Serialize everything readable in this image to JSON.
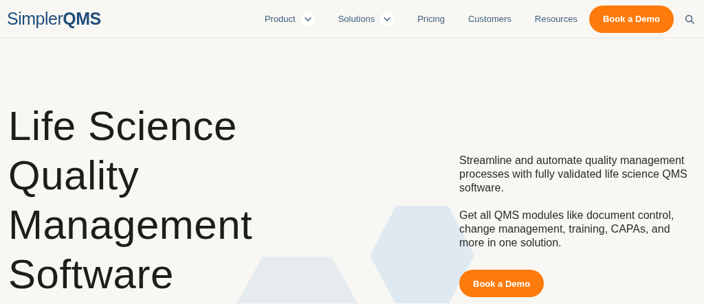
{
  "logo": {
    "name": "Simpler",
    "accent": "QMS"
  },
  "nav": [
    {
      "label": "Product",
      "dropdown": true
    },
    {
      "label": "Solutions",
      "dropdown": true
    },
    {
      "label": "Pricing",
      "dropdown": false
    },
    {
      "label": "Customers",
      "dropdown": false
    },
    {
      "label": "Resources",
      "dropdown": false
    }
  ],
  "header_cta": "Book a Demo",
  "hero": {
    "title_lines": [
      "Life Science",
      "Quality",
      "Management",
      "Software"
    ],
    "paragraphs": [
      "Streamline and automate quality management processes with fully validated life science QMS software.",
      "Get all QMS modules like document control, change management, training, CAPAs, and more in one solution."
    ],
    "cta": "Book a Demo"
  }
}
